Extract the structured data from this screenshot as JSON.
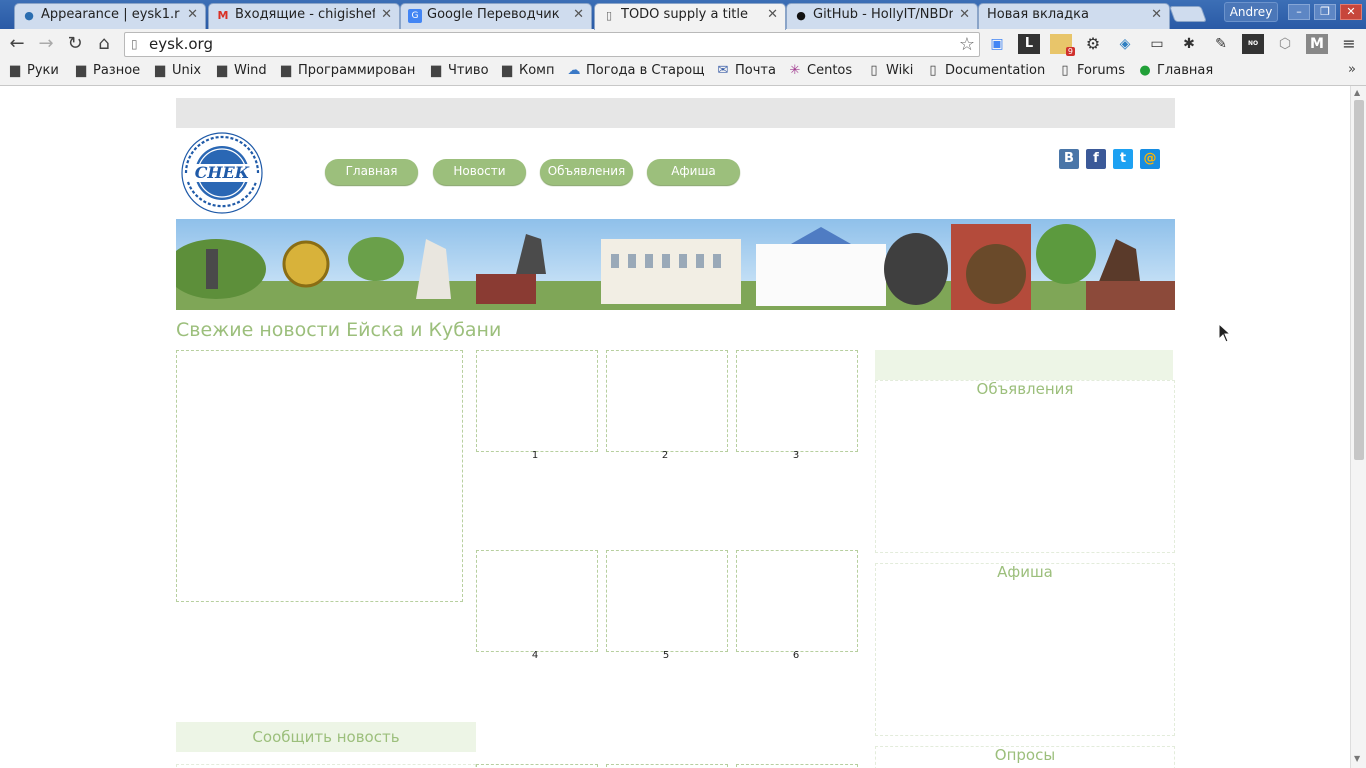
{
  "browser": {
    "tabs": [
      {
        "title": "Appearance | eysk1.r",
        "icon": "drupal-icon"
      },
      {
        "title": "Входящие - chigishef",
        "icon": "gmail-icon"
      },
      {
        "title": "Google Переводчик",
        "icon": "translate-icon"
      },
      {
        "title": "TODO supply a title",
        "icon": "page-icon",
        "active": true
      },
      {
        "title": "GitHub - HollyIT/NBDr",
        "icon": "github-icon"
      },
      {
        "title": "Новая вкладка",
        "icon": ""
      }
    ],
    "profile_name": "Andrey",
    "url": "eysk.org",
    "bookmarks": [
      {
        "label": "Руки",
        "icon": "folder-icon"
      },
      {
        "label": "Разное",
        "icon": "folder-icon"
      },
      {
        "label": "Unix",
        "icon": "folder-icon"
      },
      {
        "label": "Wind",
        "icon": "folder-icon"
      },
      {
        "label": "Программирован",
        "icon": "folder-icon"
      },
      {
        "label": "Чтиво",
        "icon": "folder-icon"
      },
      {
        "label": "Комп",
        "icon": "folder-icon"
      },
      {
        "label": "Погода в Старощ",
        "icon": "weather-icon"
      },
      {
        "label": "Почта",
        "icon": "mail-icon"
      },
      {
        "label": "Centos",
        "icon": "centos-icon"
      },
      {
        "label": "Wiki",
        "icon": "page-icon"
      },
      {
        "label": "Documentation",
        "icon": "page-icon"
      },
      {
        "label": "Forums",
        "icon": "page-icon"
      },
      {
        "label": "Главная",
        "icon": "sber-icon"
      }
    ],
    "extension_badge": "9"
  },
  "site": {
    "logo_text": "СНЕК",
    "logo_ring_text": "Свежие Новости Ейска и Кубани",
    "menu": [
      "Главная",
      "Новости",
      "Объявления",
      "Афиша"
    ],
    "social": [
      {
        "name": "vk-icon",
        "glyph": "В",
        "color": "#4a76a8"
      },
      {
        "name": "facebook-icon",
        "glyph": "f",
        "color": "#3b5998"
      },
      {
        "name": "twitter-icon",
        "glyph": "t",
        "color": "#1da1f2"
      },
      {
        "name": "mailru-icon",
        "glyph": "@",
        "color": "#168de2"
      }
    ],
    "title": "Свежие новости Ейска и Кубани",
    "thumb_numbers": [
      "1",
      "2",
      "3",
      "4",
      "5",
      "6"
    ],
    "sidebar": {
      "ads_title": "Объявления",
      "events_title": "Афиша",
      "polls_title": "Опросы"
    },
    "report_news": "Сообщить новость",
    "accent_color": "#9cbf7c"
  }
}
